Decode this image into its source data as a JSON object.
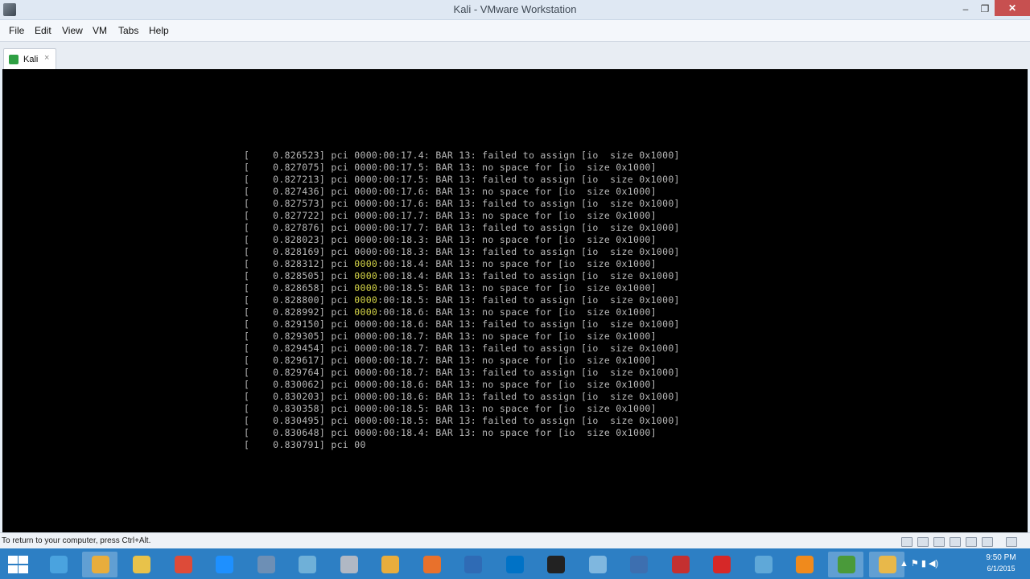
{
  "window": {
    "title": "Kali - VMware Workstation",
    "min_glyph": "–",
    "max_glyph": "❐",
    "close_glyph": "✕"
  },
  "menu": [
    "File",
    "Edit",
    "View",
    "VM",
    "Tabs",
    "Help"
  ],
  "tab": {
    "label": "Kali",
    "close_glyph": "×",
    "icon": "vm-icon"
  },
  "console": {
    "lines": [
      "[    0.826523] pci 0000:00:17.4: BAR 13: failed to assign [io  size 0x1000]",
      "[    0.827075] pci 0000:00:17.5: BAR 13: no space for [io  size 0x1000]",
      "[    0.827213] pci 0000:00:17.5: BAR 13: failed to assign [io  size 0x1000]",
      "[    0.827436] pci 0000:00:17.6: BAR 13: no space for [io  size 0x1000]",
      "[    0.827573] pci 0000:00:17.6: BAR 13: failed to assign [io  size 0x1000]",
      "[    0.827722] pci 0000:00:17.7: BAR 13: no space for [io  size 0x1000]",
      "[    0.827876] pci 0000:00:17.7: BAR 13: failed to assign [io  size 0x1000]",
      "[    0.828023] pci 0000:00:18.3: BAR 13: no space for [io  size 0x1000]",
      "[    0.828169] pci 0000:00:18.3: BAR 13: failed to assign [io  size 0x1000]",
      "[    0.828312] pci 0000:00:18.4: BAR 13: no space for [io  size 0x1000]",
      "[    0.828505] pci 0000:00:18.4: BAR 13: failed to assign [io  size 0x1000]",
      "[    0.828658] pci 0000:00:18.5: BAR 13: no space for [io  size 0x1000]",
      "[    0.828800] pci 0000:00:18.5: BAR 13: failed to assign [io  size 0x1000]",
      "[    0.828992] pci 0000:00:18.6: BAR 13: no space for [io  size 0x1000]",
      "[    0.829150] pci 0000:00:18.6: BAR 13: failed to assign [io  size 0x1000]",
      "[    0.829305] pci 0000:00:18.7: BAR 13: no space for [io  size 0x1000]",
      "[    0.829454] pci 0000:00:18.7: BAR 13: failed to assign [io  size 0x1000]",
      "[    0.829617] pci 0000:00:18.7: BAR 13: no space for [io  size 0x1000]",
      "[    0.829764] pci 0000:00:18.7: BAR 13: failed to assign [io  size 0x1000]",
      "[    0.830062] pci 0000:00:18.6: BAR 13: no space for [io  size 0x1000]",
      "[    0.830203] pci 0000:00:18.6: BAR 13: failed to assign [io  size 0x1000]",
      "[    0.830358] pci 0000:00:18.5: BAR 13: no space for [io  size 0x1000]",
      "[    0.830495] pci 0000:00:18.5: BAR 13: failed to assign [io  size 0x1000]",
      "[    0.830648] pci 0000:00:18.4: BAR 13: no space for [io  size 0x1000]",
      "[    0.830791] pci 00"
    ],
    "highlight_color": "#d8d84a"
  },
  "statusbar": {
    "text": "To return to your computer, press Ctrl+Alt."
  },
  "taskbar": {
    "icons": [
      "start-icon",
      "sharing-icon",
      "kali-vm-icon",
      "file-explorer-icon",
      "chrome-icon",
      "internet-explorer-icon",
      "virtualbox-icon",
      "network-icon",
      "photo-icon",
      "media-player-icon",
      "firefox-icon",
      "remote-desktop-icon",
      "outlook-icon",
      "command-prompt-icon",
      "notepad-icon",
      "vmware-icon",
      "no-entry-icon",
      "recorder-icon",
      "wifi-icon",
      "vlc-icon",
      "globe-icon",
      "folder-icon"
    ],
    "clock_time": "9:50 PM",
    "clock_date": "6/1/2015",
    "accent": "#2d7fc4"
  }
}
